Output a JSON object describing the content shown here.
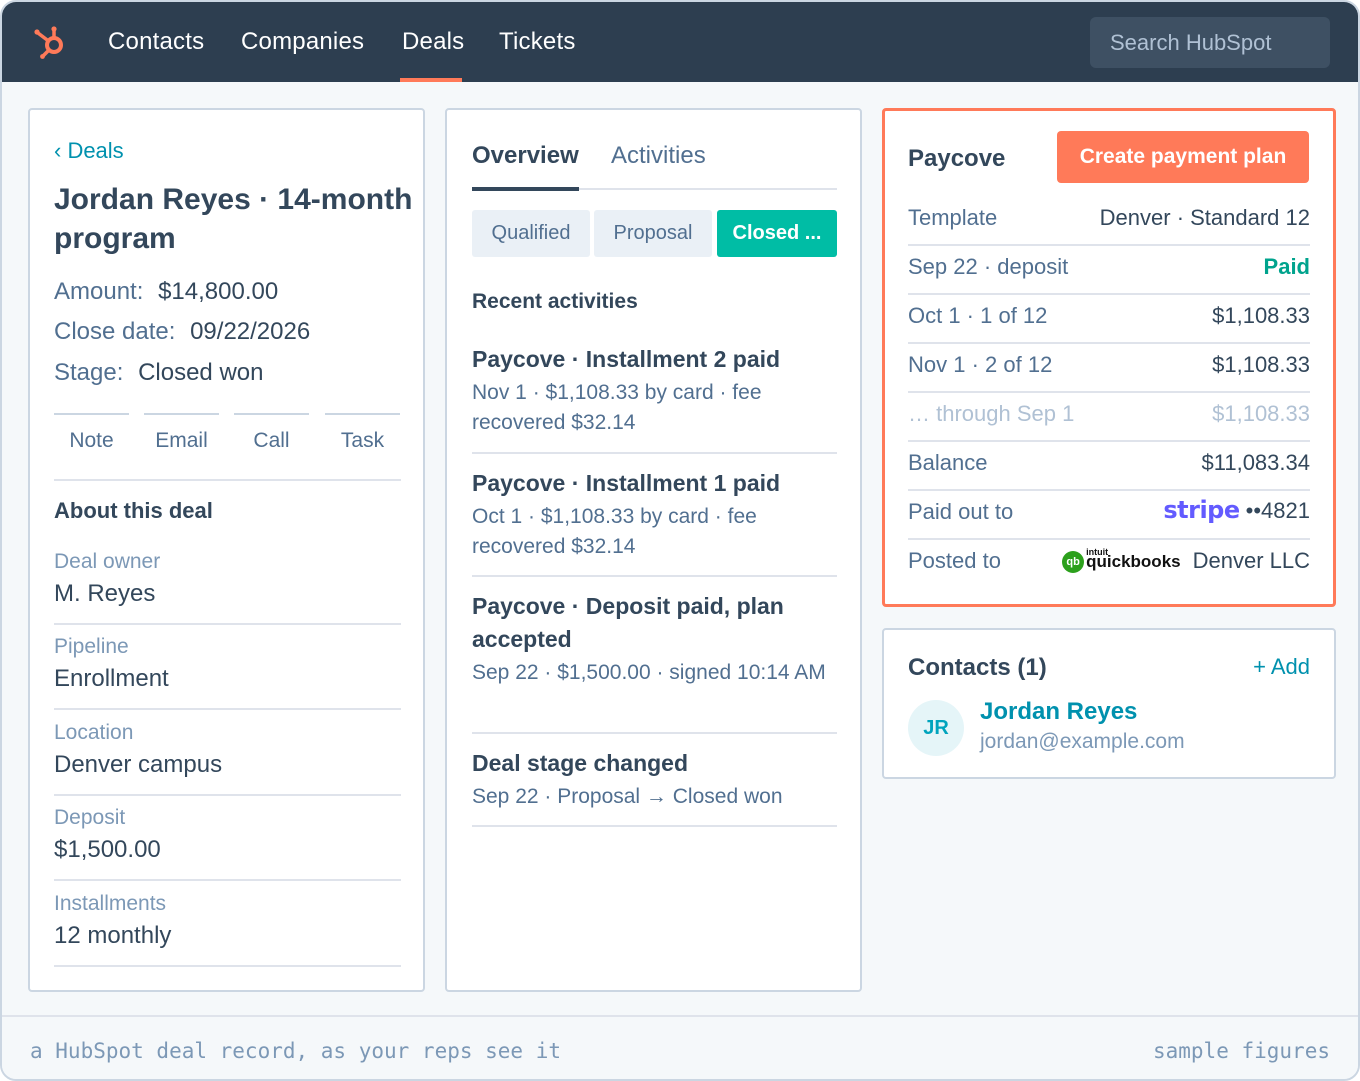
{
  "nav": {
    "logo_icon": "hubspot-sprocket-icon",
    "items": [
      "Contacts",
      "Companies",
      "Deals",
      "Tickets"
    ],
    "active": "Deals",
    "search_placeholder": "Search HubSpot",
    "accent": "#ff7a59"
  },
  "deal": {
    "back": "‹ Deals",
    "title": "Jordan Reyes · 14-month program",
    "amount_label": "Amount:",
    "amount": "$14,800.00",
    "close_label": "Close date:",
    "close": "09/22/2026",
    "stage_label": "Stage:",
    "stage": "Closed won",
    "actions": [
      "Note",
      "Email",
      "Call",
      "Task"
    ],
    "about_title": "About this deal",
    "props": [
      {
        "label": "Deal owner",
        "value": "M. Reyes"
      },
      {
        "label": "Pipeline",
        "value": "Enrollment"
      },
      {
        "label": "Location",
        "value": "Denver campus"
      },
      {
        "label": "Deposit",
        "value": "$1,500.00"
      },
      {
        "label": "Installments",
        "value": "12 monthly"
      }
    ]
  },
  "middle": {
    "tabs": [
      "Overview",
      "Activities"
    ],
    "stages": [
      "Qualified",
      "Proposal",
      "Closed ..."
    ],
    "recent_title": "Recent activities",
    "activities": [
      {
        "title": "Paycove · Installment 2 paid",
        "detail": "Nov 1 · $1,108.33 by card · fee recovered $32.14"
      },
      {
        "title": "Paycove · Installment 1 paid",
        "detail": "Oct 1 · $1,108.33 by card · fee recovered $32.14"
      },
      {
        "title": "Paycove · Deposit paid, plan accepted",
        "detail": "Sep 22 · $1,500.00 · signed 10:14 AM"
      },
      {
        "title": "Deal stage changed",
        "detail": "Sep 22 · Proposal → Closed won"
      }
    ]
  },
  "paycove": {
    "title": "Paycove",
    "button": "Create payment plan",
    "rows": [
      {
        "label": "Template",
        "value": "Denver · Standard 12"
      },
      {
        "label": "Sep 22 · deposit",
        "value": "Paid"
      },
      {
        "label": "Oct 1 · 1 of 12",
        "value": "$1,108.33"
      },
      {
        "label": "Nov 1 · 2 of 12",
        "value": "$1,108.33"
      },
      {
        "label": "… through Sep 1",
        "value": "$1,108.33"
      },
      {
        "label": "Balance",
        "value": "$11,083.34"
      },
      {
        "label": "Paid out to",
        "logo": "stripe",
        "value": "••4821"
      },
      {
        "label": "Posted to",
        "logo_small": "intuit",
        "logo": "quickbooks",
        "value": "Denver LLC"
      }
    ],
    "border_color": "#ff7a59",
    "paid_color": "#00a38d",
    "stripe_color": "#635bff"
  },
  "contacts": {
    "title": "Contacts (1)",
    "add": "+ Add",
    "initials": "JR",
    "name": "Jordan Reyes",
    "email": "jordan@example.com"
  },
  "footer": {
    "left": "a HubSpot deal record, as your reps see it",
    "right": "sample figures"
  }
}
